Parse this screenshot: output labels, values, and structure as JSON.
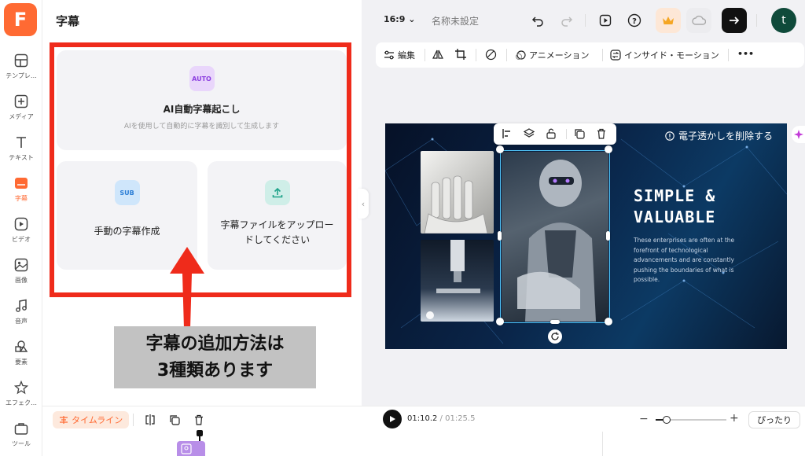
{
  "app": {
    "logo_letter": "F",
    "accent": "#ff6a33"
  },
  "sidebar": {
    "items": [
      {
        "label": "テンプレ…",
        "icon": "template-icon"
      },
      {
        "label": "メディア",
        "icon": "media-upload-icon"
      },
      {
        "label": "テキスト",
        "icon": "text-icon"
      },
      {
        "label": "字幕",
        "icon": "subtitle-icon",
        "active": true
      },
      {
        "label": "ビデオ",
        "icon": "video-icon"
      },
      {
        "label": "画像",
        "icon": "image-icon"
      },
      {
        "label": "音声",
        "icon": "music-icon"
      },
      {
        "label": "要素",
        "icon": "elements-icon"
      },
      {
        "label": "エフェク…",
        "icon": "effects-icon"
      },
      {
        "label": "ツール",
        "icon": "tools-icon"
      }
    ]
  },
  "panel": {
    "title": "字幕",
    "auto_card": {
      "badge": "AUTO",
      "title": "AI自動字幕起こし",
      "subtitle": "AIを使用して自動的に字幕を識別して生成します"
    },
    "manual_card": {
      "badge": "SUB",
      "title": "手動の字幕作成"
    },
    "upload_card": {
      "title_line1": "字幕ファイルをアップロー",
      "title_line2": "ドしてください"
    }
  },
  "annotation": {
    "line1": "字幕の追加方法は",
    "line2": "3種類あります",
    "box_color": "#ef2b1b"
  },
  "topbar": {
    "ratio": "16:9",
    "doc_name": "名称未設定",
    "avatar_letter": "t"
  },
  "toolbar2": {
    "edit": "編集",
    "animation": "アニメーション",
    "inside_motion": "インサイド・モーション"
  },
  "design": {
    "remove_watermark": "電子透かしを削除する",
    "headline_line1": "SIMPLE &",
    "headline_line2": "VALUABLE",
    "body": "These enterprises are often at the forefront of technological advancements and are constantly pushing the boundaries of what is possible."
  },
  "timeline": {
    "button": "タイムライン",
    "current": "01:10.2",
    "total": "/ 01:25.5",
    "fit": "ぴったり",
    "zoom_level": 0.15
  }
}
